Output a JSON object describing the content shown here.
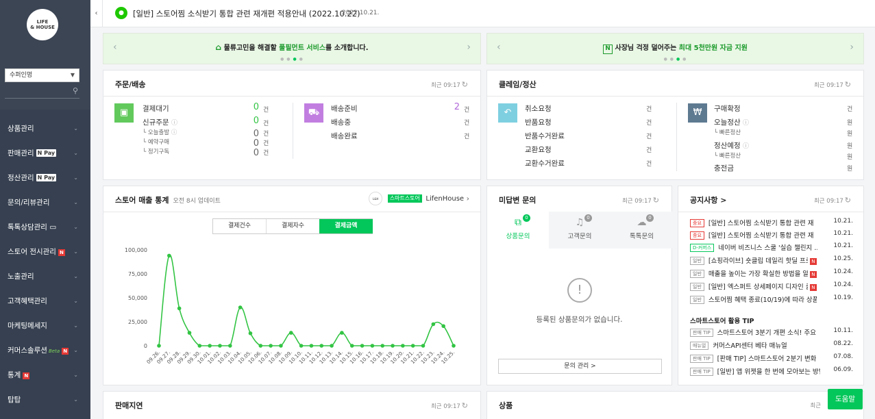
{
  "sidebar": {
    "logo_text_line1": "LIFE",
    "logo_text_line2": "& HOUSE",
    "role_select": "수퍼인멍",
    "menu": [
      {
        "label": "상품관리"
      },
      {
        "label": "판매관리",
        "badge": "Pay"
      },
      {
        "label": "정산관리",
        "badge": "Pay"
      },
      {
        "label": "문의/리뷰관리"
      },
      {
        "label": "톡톡상담관리"
      },
      {
        "label": "스토어 전시관리",
        "new": "N"
      },
      {
        "label": "노출관리"
      },
      {
        "label": "고객혜택관리"
      },
      {
        "label": "마케팅메세지"
      },
      {
        "label": "커머스솔루션",
        "beta": "Beta",
        "new": "N"
      },
      {
        "label": "통계",
        "new": "N"
      },
      {
        "label": "탑탑"
      }
    ]
  },
  "topbar": {
    "notice": "[일반] 스토어찜 소식받기 통합 관련 재개편 적용안내 (2022.10.22)",
    "date": "2022.10.21."
  },
  "banners": [
    {
      "pre": "물류고민을 해결할 ",
      "highlight": "풀필먼트 서비스",
      "post": "를 소개합니다."
    },
    {
      "pre": "사장님 걱정 덜어주는 ",
      "highlight": "최대 5천만원 자금 지원",
      "post": ""
    }
  ],
  "orders": {
    "title": "주문/배송",
    "updated": "최근 09:17",
    "left": [
      {
        "label": "결제대기",
        "value": "0",
        "unit": "건"
      },
      {
        "label": "신규주문",
        "value": "0",
        "unit": "건"
      },
      {
        "label": "오늘출발",
        "value": "0",
        "unit": "건"
      },
      {
        "label": "예약구매",
        "value": "0",
        "unit": "건"
      },
      {
        "label": "정기구독",
        "value": "0",
        "unit": "건"
      }
    ],
    "right": [
      {
        "label": "배송준비",
        "value": "2",
        "unit": "건"
      },
      {
        "label": "배송중",
        "unit": "건"
      },
      {
        "label": "배송완료",
        "unit": "건"
      }
    ]
  },
  "claims": {
    "title": "클레임/정산",
    "updated": "최근 09:17",
    "left": [
      {
        "label": "취소요청",
        "unit": "건"
      },
      {
        "label": "반품요청",
        "unit": "건"
      },
      {
        "label": "반품수거완료",
        "unit": "건"
      },
      {
        "label": "교환요청",
        "unit": "건"
      },
      {
        "label": "교환수거완료",
        "unit": "건"
      }
    ],
    "right": [
      {
        "label": "구매확정",
        "unit": "건"
      },
      {
        "label": "오늘정산",
        "unit": "원"
      },
      {
        "label": "빠른정산",
        "unit": "원"
      },
      {
        "label": "정산예정",
        "unit": "원"
      },
      {
        "label": "빠른정산",
        "unit": "원"
      },
      {
        "label": "충전금",
        "unit": "원"
      }
    ]
  },
  "sales": {
    "title": "스토어 매출 통계",
    "subtitle": "오전 8시 업데이트",
    "store_badge": "스마트스토어",
    "store_name": "LifenHouse",
    "tabs": [
      "결제건수",
      "결제자수",
      "결제금액"
    ],
    "active_tab": 2
  },
  "chart_data": {
    "type": "line",
    "x": [
      "09.26.",
      "09.27.",
      "09.28.",
      "09.29.",
      "09.30.",
      "10.01.",
      "10.02.",
      "10.03.",
      "10.04.",
      "10.05.",
      "10.06.",
      "10.07.",
      "10.08.",
      "10.09.",
      "10.10.",
      "10.11.",
      "10.12.",
      "10.13.",
      "10.14.",
      "10.15.",
      "10.16.",
      "10.17.",
      "10.18.",
      "10.19.",
      "10.20.",
      "10.21.",
      "10.22.",
      "10.23.",
      "10.24.",
      "10.25."
    ],
    "values": [
      0,
      94000,
      39000,
      13500,
      0,
      0,
      0,
      0,
      40000,
      13000,
      0,
      0,
      0,
      13500,
      0,
      0,
      0,
      0,
      13500,
      0,
      0,
      0,
      0,
      0,
      0,
      0,
      0,
      22500,
      20500,
      0
    ],
    "yticks": [
      "0",
      "25,000",
      "50,000",
      "75,000",
      "100,000"
    ],
    "ylim": [
      0,
      100000
    ],
    "grid": false,
    "color": "#32c443"
  },
  "inquiries": {
    "title": "미답변 문의",
    "updated": "최근 09:17",
    "tabs": [
      {
        "label": "상품문의",
        "count": "0"
      },
      {
        "label": "고객문의",
        "count": "0"
      },
      {
        "label": "톡톡문의",
        "count": "0"
      }
    ],
    "empty": "등록된 상품문의가 없습니다.",
    "manage": "문의 관리 >"
  },
  "notices": {
    "title": "공지사항 >",
    "updated": "최근 09:17",
    "items": [
      {
        "tag": "중요",
        "tagType": "red",
        "title": "[일반] 스토어찜 소식받기 통합 관련 재...",
        "date": "10.21."
      },
      {
        "tag": "중요",
        "tagType": "red",
        "title": "[일반] 스토어찜 소식받기 통합 관련 재...",
        "date": "10.21."
      },
      {
        "tag": "D-커머스",
        "tagType": "green",
        "title": "네이버 비즈니스 스쿨 '실습 챌린지 ...",
        "date": "10.21."
      },
      {
        "tag": "일반",
        "tagType": "gray",
        "title": "[쇼핑라이브] 숏클립 데일리 핫딜 프로...",
        "new": "N",
        "date": "10.25."
      },
      {
        "tag": "일반",
        "tagType": "gray",
        "title": "매출을 높이는 가장 확실한 방법을 알...",
        "new": "N",
        "date": "10.24."
      },
      {
        "tag": "일반",
        "tagType": "gray",
        "title": "[일반] 엑스퍼트 상세페이지 디자인 클...",
        "new": "N",
        "date": "10.24."
      },
      {
        "tag": "일반",
        "tagType": "gray",
        "title": "스토어찜 혜택 종료(10/19)에 따라 상품 ...",
        "date": "10.19."
      }
    ],
    "tip_title": "스마트스토어 활용 TIP",
    "tips": [
      {
        "tag": "판매 TIP",
        "title": "스마트스토어 3분기 개편 소식! 주요 ...",
        "date": "10.11."
      },
      {
        "tag": "매뉴얼",
        "title": "커머스API센터 베타 매뉴얼",
        "date": "08.22."
      },
      {
        "tag": "판매 TIP",
        "title": "[판매 TIP] 스마트스토어 2분기 변화 ...",
        "date": "07.08."
      },
      {
        "tag": "판매 TIP",
        "title": "[일반] 앱 위젯을 한 번에 모아보는 방법!",
        "date": "06.09."
      }
    ]
  },
  "delay": {
    "title": "판매지연",
    "updated": "최근 09:17"
  },
  "products": {
    "title": "상품",
    "updated": "최근"
  },
  "help": "도움말"
}
